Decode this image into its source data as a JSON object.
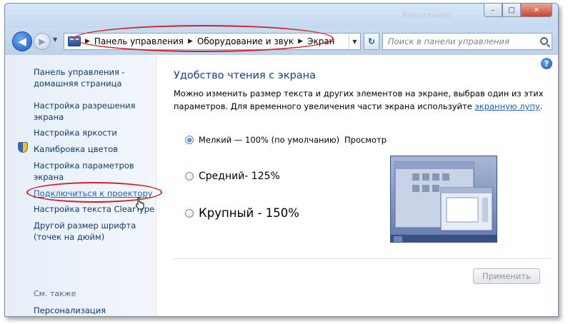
{
  "window": {
    "ghost_title": "Визуальное",
    "caption": {
      "minimize": "–",
      "maximize": "□",
      "close": "✕"
    }
  },
  "nav": {
    "back_glyph": "◀",
    "forward_glyph": "▶",
    "history_glyph": "▼",
    "breadcrumb": [
      "Панель управления",
      "Оборудование и звук",
      "Экран"
    ],
    "separator": "▶",
    "dropdown_glyph": "▼",
    "refresh_glyph": "↻",
    "search_placeholder": "Поиск в панели управления"
  },
  "sidebar": {
    "items": [
      {
        "label_line1": "Панель управления -",
        "label_line2": "домашняя страница"
      },
      {
        "label_line1": "Настройка разрешения",
        "label_line2": "экрана"
      },
      {
        "label_line1": "Настройка яркости"
      },
      {
        "label_line1": "Калибровка цветов"
      },
      {
        "label_line1": "Настройка параметров",
        "label_line2": "экрана"
      },
      {
        "label_line1": "Подключиться к проектору"
      },
      {
        "label_line1": "Настройка текста ClearType"
      },
      {
        "label_line1": "Другой размер шрифта",
        "label_line2": "(точек на дюйм)"
      }
    ],
    "see_also_title": "См. также",
    "see_also_items": [
      "Персонализация"
    ]
  },
  "content": {
    "title": "Удобство чтения с экрана",
    "desc_line1": "Можно изменить размер текста и других элементов на экране, выбрав один из этих",
    "desc_line2": "параметров. Для временного увеличения части экрана используйте ",
    "magnifier_link": "экранную лупу",
    "desc_end": ".",
    "options": [
      {
        "label": "Мелкий — 100% (по умолчанию)",
        "checked": true
      },
      {
        "label": "Средний- 125%",
        "checked": false
      },
      {
        "label": "Крупный - 150%",
        "checked": false
      }
    ],
    "preview_label": "Просмотр",
    "apply_label": "Применить"
  },
  "help_glyph": "?",
  "colors": {
    "link": "#1f5fb8",
    "heading": "#1e3a8a",
    "highlight_ellipse": "#d2202a"
  }
}
